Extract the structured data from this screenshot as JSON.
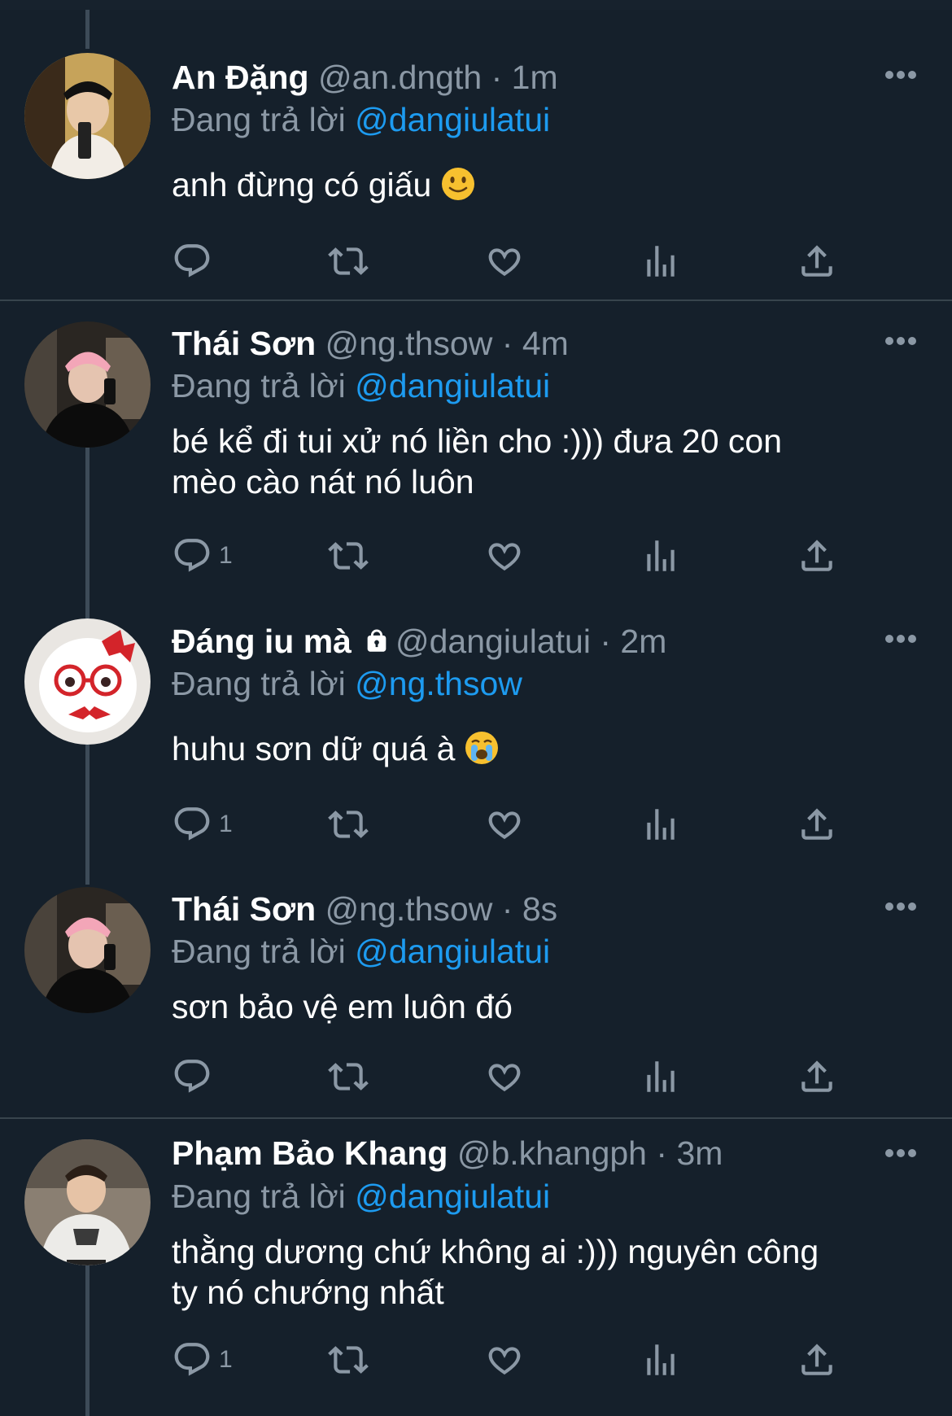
{
  "colors": {
    "background": "#15202b",
    "text": "#ffffff",
    "muted": "#8b98a5",
    "mention": "#1d9bf0",
    "divider": "#38444d"
  },
  "reply_prefix": "Đang trả lời",
  "dot": "·",
  "tweets": [
    {
      "name": "An Đặng",
      "handle": "@an.dngth",
      "time": "1m",
      "reply_to": "@dangiulatui",
      "text": "anh đừng có giấu",
      "emoji": "slightly-smiling-face",
      "reply_count": ""
    },
    {
      "name": "Thái Sơn",
      "handle": "@ng.thsow",
      "time": "4m",
      "reply_to": "@dangiulatui",
      "text_line1": "bé kể đi tui xử nó liền cho :))) đưa 20 con",
      "text_line2": "mèo cào nát nó luôn",
      "reply_count": "1"
    },
    {
      "name": "Đáng iu mà",
      "protected_icon": "lock-icon",
      "handle": "@dangiulatui",
      "time": "2m",
      "reply_to": "@ng.thsow",
      "text": "huhu sơn dữ quá à",
      "emoji": "loudly-crying-face",
      "reply_count": "1"
    },
    {
      "name": "Thái Sơn",
      "handle": "@ng.thsow",
      "time": "8s",
      "reply_to": "@dangiulatui",
      "text": "sơn bảo vệ em luôn đó",
      "reply_count": ""
    },
    {
      "name": "Phạm Bảo Khang",
      "handle": "@b.khangph",
      "time": "3m",
      "reply_to": "@dangiulatui",
      "text_line1": "thằng dương chứ không ai :))) nguyên công",
      "text_line2": "ty nó chướng nhất",
      "reply_count": "1"
    }
  ],
  "action_icons": [
    "reply-icon",
    "retweet-icon",
    "like-icon",
    "views-icon",
    "share-icon"
  ]
}
